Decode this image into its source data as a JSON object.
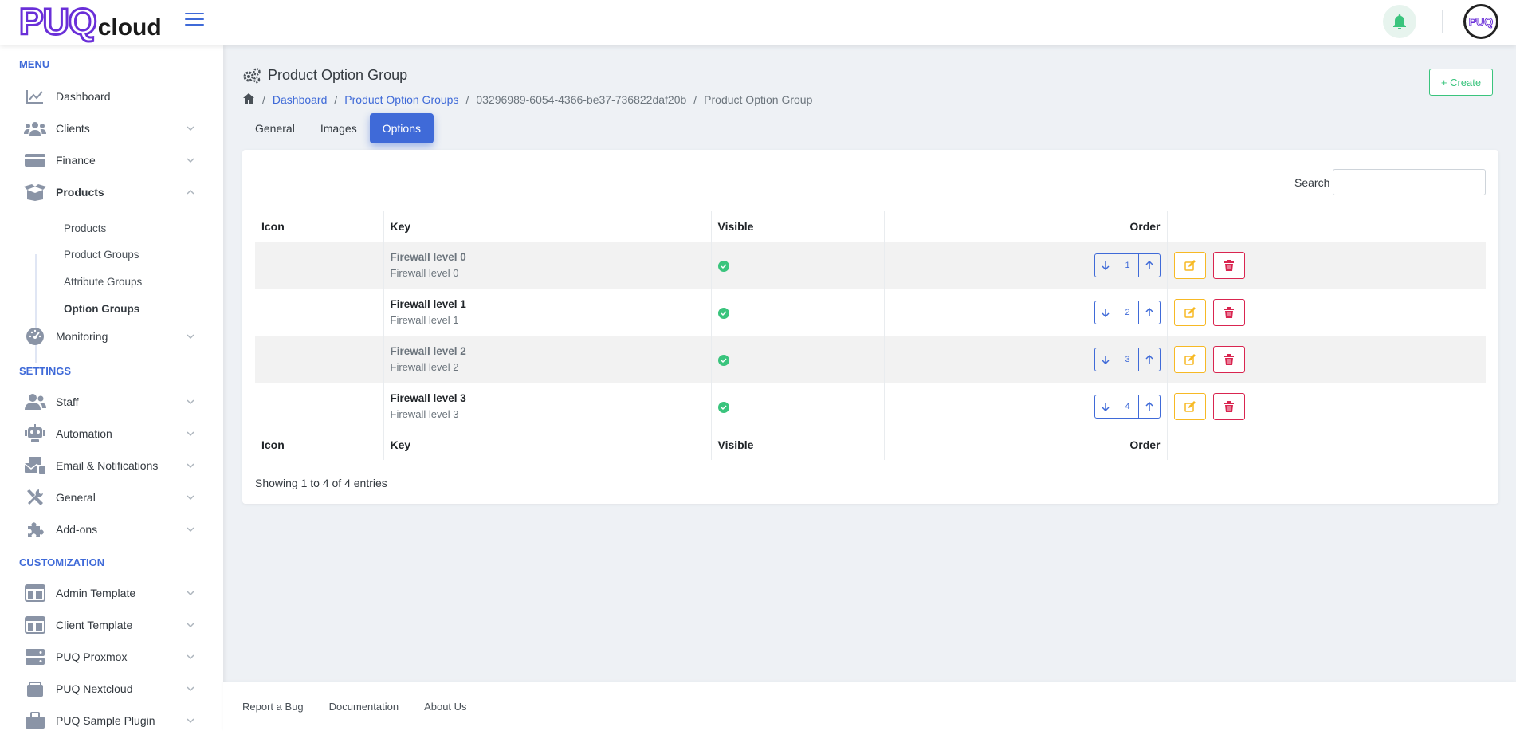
{
  "brand": {
    "logo_main": "PUQ",
    "logo_suffix": "cloud",
    "avatar_text": "PUQ"
  },
  "colors": {
    "primary": "#3f6ad8",
    "success": "#3ac47d",
    "warning": "#f7b924",
    "danger": "#d92550",
    "brand": "#6a2fd8"
  },
  "sidebar": {
    "menu_heading": "MENU",
    "settings_heading": "SETTINGS",
    "customization_heading": "CUSTOMIZATION",
    "menu_items": [
      {
        "label": "Dashboard",
        "icon": "chart-line-icon"
      },
      {
        "label": "Clients",
        "icon": "users-icon"
      },
      {
        "label": "Finance",
        "icon": "credit-card-icon"
      },
      {
        "label": "Products",
        "icon": "box-open-icon"
      },
      {
        "label": "Monitoring",
        "icon": "gauge-icon"
      }
    ],
    "products_sub": [
      "Products",
      "Product Groups",
      "Attribute Groups",
      "Option Groups"
    ],
    "settings_items": [
      {
        "label": "Staff",
        "icon": "staff-icon"
      },
      {
        "label": "Automation",
        "icon": "robot-icon"
      },
      {
        "label": "Email & Notifications",
        "icon": "mail-bulk-icon"
      },
      {
        "label": "General",
        "icon": "tools-icon"
      },
      {
        "label": "Add-ons",
        "icon": "puzzle-icon"
      }
    ],
    "customization_items": [
      {
        "label": "Admin Template",
        "icon": "layout-icon"
      },
      {
        "label": "Client Template",
        "icon": "layout-icon"
      },
      {
        "label": "PUQ Proxmox",
        "icon": "server-icon"
      },
      {
        "label": "PUQ Nextcloud",
        "icon": "cloud-box-icon"
      },
      {
        "label": "PUQ Sample Plugin",
        "icon": "briefcase-icon"
      }
    ]
  },
  "page": {
    "title": "Product Option Group",
    "create_label": "+ Create",
    "breadcrumb": [
      "Dashboard",
      "Product Option Groups",
      "03296989-6054-4366-be37-736822daf20b",
      "Product Option Group"
    ],
    "tabs": [
      "General",
      "Images",
      "Options"
    ]
  },
  "table": {
    "search_label": "Search",
    "search_value": "",
    "headers": {
      "icon": "Icon",
      "key": "Key",
      "visible": "Visible",
      "order": "Order"
    },
    "rows": [
      {
        "title": "Firewall level 0",
        "subtitle": "Firewall level 0",
        "order": "1",
        "visible": true
      },
      {
        "title": "Firewall level 1",
        "subtitle": "Firewall level 1",
        "order": "2",
        "visible": true
      },
      {
        "title": "Firewall level 2",
        "subtitle": "Firewall level 2",
        "order": "3",
        "visible": true
      },
      {
        "title": "Firewall level 3",
        "subtitle": "Firewall level 3",
        "order": "4",
        "visible": true
      }
    ],
    "info": "Showing 1 to 4 of 4 entries"
  },
  "footer": {
    "links": [
      "Report a Bug",
      "Documentation",
      "About Us"
    ]
  }
}
